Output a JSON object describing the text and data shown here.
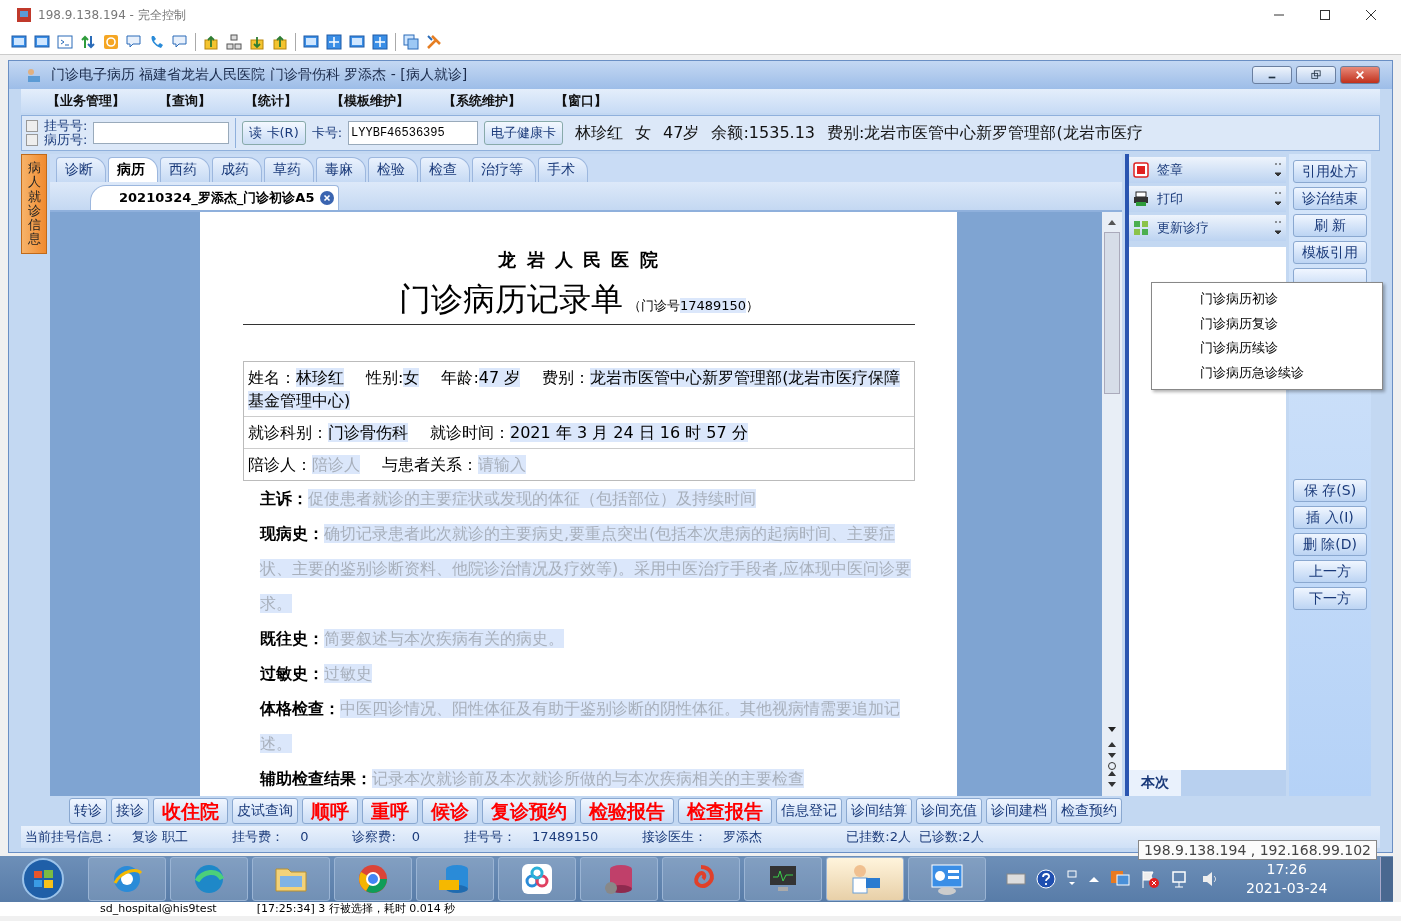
{
  "remote_window": {
    "title": "198.9.138.194 - 完全控制"
  },
  "app": {
    "title": "门诊电子病历  福建省龙岩人民医院  门诊骨伤科  罗添杰 - [病人就诊]"
  },
  "menu": [
    "【业务管理】",
    "【查询】",
    "【统计】",
    "【模板维护】",
    "【系统维护】",
    "【窗口】"
  ],
  "patient_bar": {
    "checks": [
      {
        "label": "挂号号:",
        "checked": false
      },
      {
        "label": "病历号:",
        "checked": false
      }
    ],
    "read_card": "读 卡(R)",
    "card_label": "卡号:",
    "card_no": "LYYBF46536395",
    "health_card": "电子健康卡",
    "info": [
      "林珍红",
      "女",
      "47岁",
      "余额:1535.13",
      "费别:龙岩市医管中心新罗管理部(龙岩市医疗"
    ]
  },
  "side_tab": "病人就诊信息",
  "tabs": [
    {
      "label": "诊断",
      "selected": false
    },
    {
      "label": "病历",
      "selected": true
    },
    {
      "label": "西药",
      "selected": false
    },
    {
      "label": "成药",
      "selected": false
    },
    {
      "label": "草药",
      "selected": false
    },
    {
      "label": "毒麻",
      "selected": false
    },
    {
      "label": "检验",
      "selected": false
    },
    {
      "label": "检查",
      "selected": false
    },
    {
      "label": "治疗等",
      "selected": false
    },
    {
      "label": "手术",
      "selected": false
    }
  ],
  "doc_tab": {
    "label": "20210324_罗添杰_门诊初诊A5"
  },
  "document": {
    "hospital": "龙 岩 人 民 医 院",
    "title": "门诊病历记录单",
    "title_note_label": "（门诊号",
    "title_note_value": "17489150",
    "title_note_end": "）",
    "info_rows": [
      [
        {
          "label": "姓名：",
          "value": "林珍红"
        },
        {
          "label": "性别:",
          "value": "女"
        },
        {
          "label": "年龄:",
          "value": "47 岁"
        },
        {
          "label": "费别：",
          "value": "龙岩市医管中心新罗管理部(龙岩市医疗保障基金管理中心)"
        }
      ],
      [
        {
          "label": "就诊科别：",
          "value": "门诊骨伤科"
        },
        {
          "label": "就诊时间：",
          "value": "2021 年 3 月 24 日 16 时 57 分"
        }
      ],
      [
        {
          "label": "陪诊人：",
          "placeholder": "陪诊人"
        },
        {
          "label": "与患者关系：",
          "placeholder": "请输入"
        }
      ]
    ],
    "sections": [
      {
        "label": "主诉：",
        "placeholder": "促使患者就诊的主要症状或发现的体征（包括部位）及持续时间"
      },
      {
        "label": "现病史：",
        "placeholder": "确切记录患者此次就诊的主要病史,要重点突出(包括本次患病的起病时间、主要症状、主要的鉴别诊断资料、他院诊治情况及疗效等)。采用中医治疗手段者,应体现中医问诊要求。"
      },
      {
        "label": "既往史：",
        "placeholder": "简要叙述与本次疾病有关的病史。"
      },
      {
        "label": "过敏史：",
        "placeholder": "过敏史"
      },
      {
        "label": "体格检查：",
        "placeholder": "中医四诊情况、阳性体征及有助于鉴别诊断的阴性体征。其他视病情需要追加记述。"
      },
      {
        "label": "辅助检查结果：",
        "placeholder": "记录本次就诊前及本次就诊所做的与本次疾病相关的主要检查"
      }
    ]
  },
  "actions": [
    {
      "label": "签章",
      "kind": "seal"
    },
    {
      "label": "打印",
      "kind": "print"
    },
    {
      "label": "更新诊疗",
      "kind": "update"
    }
  ],
  "popup_menu": [
    "门诊病历初诊",
    "门诊病历复诊",
    "门诊病历续诊",
    "门诊病历急诊续诊"
  ],
  "lower_tabs": [
    {
      "label": "本次",
      "selected": true
    }
  ],
  "side_buttons_top": [
    "引用处方",
    "诊治结束",
    "刷 新",
    "模板引用"
  ],
  "side_buttons_bottom": [
    "保 存(S)",
    "插 入(I)",
    "删 除(D)",
    "上一方",
    "下一方"
  ],
  "bottom_buttons": [
    {
      "label": "转诊",
      "kind": "normal"
    },
    {
      "label": "接诊",
      "kind": "normal"
    },
    {
      "label": "收住院",
      "kind": "alert"
    },
    {
      "label": "皮试查询",
      "kind": "normal"
    },
    {
      "label": "顺呼",
      "kind": "alert"
    },
    {
      "label": "重呼",
      "kind": "alert"
    },
    {
      "label": "候诊",
      "kind": "alert"
    },
    {
      "label": "复诊预约",
      "kind": "alert"
    },
    {
      "label": "检验报告",
      "kind": "alert"
    },
    {
      "label": "检查报告",
      "kind": "alert"
    },
    {
      "label": "信息登记",
      "kind": "normal"
    },
    {
      "label": "诊间结算",
      "kind": "normal"
    },
    {
      "label": "诊间充值",
      "kind": "normal"
    },
    {
      "label": "诊间建档",
      "kind": "normal"
    },
    {
      "label": "检查预约",
      "kind": "normal"
    }
  ],
  "status": [
    {
      "label": "当前挂号信息：",
      "value": "复诊 职工"
    },
    {
      "label": "挂号费：",
      "value": "0"
    },
    {
      "label": "诊察费:",
      "value": "0"
    },
    {
      "label": "挂号号：",
      "value": "17489150"
    },
    {
      "label": "接诊医生：",
      "value": "罗添杰"
    },
    {
      "label": "已挂数:2人"
    },
    {
      "label": "已诊数:2人"
    }
  ],
  "tooltip": "198.9.138.194 , 192.168.99.102",
  "taskbar_apps": [
    {
      "kind": "browser",
      "active": false
    },
    {
      "kind": "wave",
      "active": false
    },
    {
      "kind": "folder",
      "active": false
    },
    {
      "kind": "wheel",
      "active": false
    },
    {
      "kind": "sql",
      "active": false
    },
    {
      "kind": "rings",
      "active": false
    },
    {
      "kind": "database",
      "active": false
    },
    {
      "kind": "spiral",
      "active": false
    },
    {
      "kind": "monitor",
      "active": false
    },
    {
      "kind": "doctor",
      "active": true
    },
    {
      "kind": "panel",
      "active": false
    }
  ],
  "clock": {
    "time": "17:26",
    "date": "2021-03-24"
  },
  "behind_text": [
    "sd_hospital@his9test",
    "[17:25:34]  3 行被选择，耗时 0.014 秒"
  ]
}
